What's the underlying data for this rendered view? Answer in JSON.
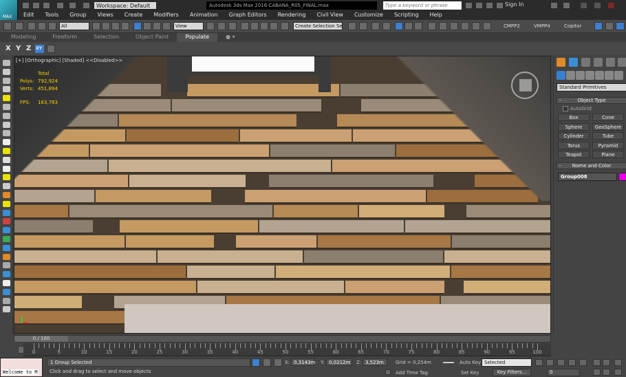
{
  "titlebar": {
    "logo_label": "MAX",
    "workspace": "Workspace: Default",
    "app_title": "Autodesk 3ds Max 2016    CABANA_R05_FINAL.max",
    "search_placeholder": "Type a keyword or phrase",
    "sign_in": "Sign In"
  },
  "menu": [
    "Edit",
    "Tools",
    "Group",
    "Views",
    "Create",
    "Modifiers",
    "Animation",
    "Graph Editors",
    "Rendering",
    "Civil View",
    "Customize",
    "Scripting",
    "Help"
  ],
  "toolbar": {
    "filter": "All",
    "ref_coord": "View",
    "selection_set": "Create Selection Se",
    "labels": [
      "CMPP2",
      "VMPP4",
      "Copitor"
    ]
  },
  "ribbon": {
    "tabs": [
      "Modeling",
      "Freeform",
      "Selection",
      "Object Paint",
      "Populate"
    ],
    "active": "Populate"
  },
  "axisbar": {
    "x": "X",
    "y": "Y",
    "z": "Z",
    "xy": "XY"
  },
  "viewport": {
    "label": "[+] [Orthographic] [Shaded]  <<Disabled>>",
    "stats": {
      "total_label": "Total",
      "polys_label": "Polys:",
      "polys_value": "792,924",
      "verts_label": "Verts:",
      "verts_value": "451,894",
      "fps_label": "FPS:",
      "fps_value": "163,783"
    }
  },
  "command_panel": {
    "category": "Standard Primitives",
    "object_type_title": "Object Type",
    "autogrid": "AutoGrid",
    "objects": [
      "Box",
      "Cone",
      "Sphere",
      "GeoSphere",
      "Cylinder",
      "Tube",
      "Torus",
      "Pyramid",
      "Teapot",
      "Plane"
    ],
    "name_color_title": "Name and Color",
    "object_name": "Group008",
    "object_color": "#e600e6"
  },
  "timeline": {
    "slider": "0 / 100",
    "ticks": [
      "0",
      "5",
      "10",
      "15",
      "20",
      "25",
      "30",
      "35",
      "40",
      "45",
      "50",
      "55",
      "60",
      "65",
      "70",
      "75",
      "80",
      "85",
      "90",
      "95",
      "100"
    ]
  },
  "status": {
    "maxscript": "Welcome to M",
    "selection": "1 Group Selected",
    "prompt": "Click and drag to select and move objects",
    "x_label": "X:",
    "x_value": "0,3143m",
    "y_label": "Y:",
    "y_value": "0,0212m",
    "z_label": "Z:",
    "z_value": "3,523m",
    "grid": "Grid = 0,254m",
    "add_time_tag": "Add Time Tag",
    "auto_key": "Auto Key",
    "set_key": "Set Key",
    "selected": "Selected",
    "key_filters": "Key Filters...",
    "frame": "0"
  }
}
